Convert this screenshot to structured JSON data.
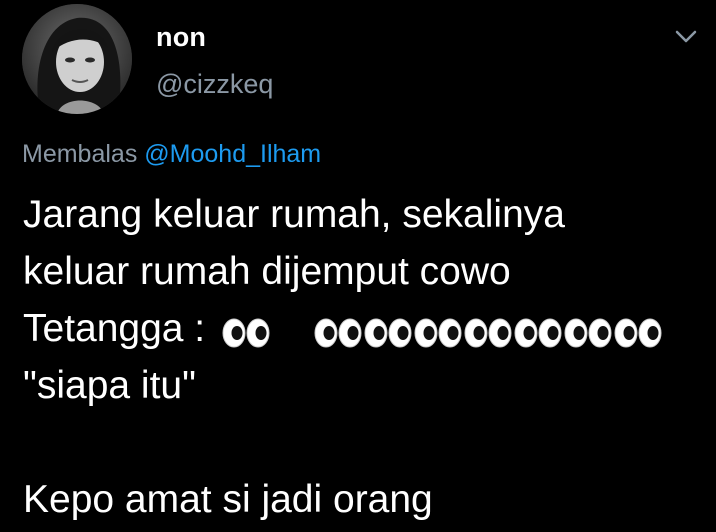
{
  "tweet": {
    "display_name": "non",
    "username": "@cizzkeq",
    "reply_prefix": "Membalas",
    "reply_to": "@Moohd_Ilham",
    "lines": {
      "l1": "Jarang keluar rumah, sekalinya",
      "l2": "keluar rumah dijemput cowo",
      "l3_text": "Tetangga :",
      "l4": "\"siapa itu\"",
      "l6": "Kepo amat si jadi orang"
    },
    "eyes_emoji_count_first": 1,
    "eyes_emoji_count_second": 7
  },
  "icons": {
    "avatar": "profile-photo",
    "menu": "chevron-down-icon",
    "emoji": "eyes-emoji"
  },
  "colors": {
    "background": "#000000",
    "text": "#ffffff",
    "secondary_text": "#8b98a5",
    "link": "#1d9bf0"
  }
}
